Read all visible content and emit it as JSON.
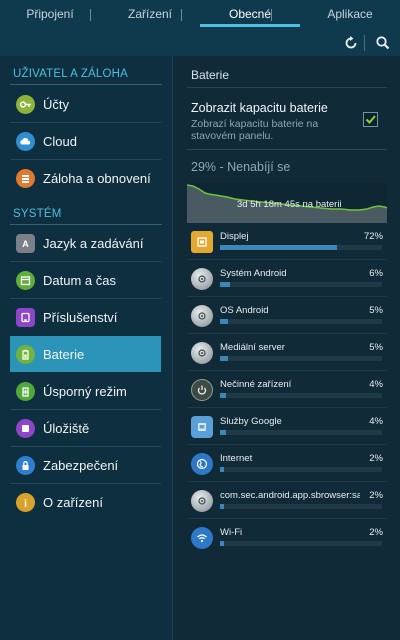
{
  "tabs": [
    {
      "label": "Připojení",
      "active": false
    },
    {
      "label": "Zařízení",
      "active": false
    },
    {
      "label": "Obecné",
      "active": true
    },
    {
      "label": "Aplikace",
      "active": false
    }
  ],
  "actionbar": {
    "refresh_icon": "refresh-icon",
    "search_icon": "search-icon"
  },
  "sidebar": {
    "section1": "UŽIVATEL A ZÁLOHA",
    "section2": "SYSTÉM",
    "items": [
      {
        "label": "Účty",
        "icon": "key-icon",
        "color": "#8cb43a"
      },
      {
        "label": "Cloud",
        "icon": "cloud-icon",
        "color": "#2f8fd0"
      },
      {
        "label": "Záloha a obnovení",
        "icon": "backup-icon",
        "color": "#e07a2e"
      },
      {
        "label": "Jazyk a zadávání",
        "icon": "keyboard-icon",
        "color": "#7a7f88"
      },
      {
        "label": "Datum a čas",
        "icon": "calendar-icon",
        "color": "#5fae3a"
      },
      {
        "label": "Příslušenství",
        "icon": "accessory-icon",
        "color": "#8e46c8"
      },
      {
        "label": "Baterie",
        "icon": "battery-icon",
        "color": "#6fb43c",
        "active": true
      },
      {
        "label": "Úsporný režim",
        "icon": "power-saving-icon",
        "color": "#4fa83a"
      },
      {
        "label": "Úložiště",
        "icon": "storage-icon",
        "color": "#8e46c8"
      },
      {
        "label": "Zabezpečení",
        "icon": "lock-icon",
        "color": "#2f7fd0"
      },
      {
        "label": "O zařízení",
        "icon": "info-icon",
        "color": "#d9a22a"
      }
    ]
  },
  "battery": {
    "title": "Baterie",
    "option_title": "Zobrazit kapacitu baterie",
    "option_desc": "Zobrazí kapacitu baterie na stavovém panelu.",
    "option_checked": true,
    "status": "29% - Nenabíjí se",
    "graph_label": "3d 5h 18m 45s na baterii",
    "usage": [
      {
        "name": "Displej",
        "pct": "72%",
        "value": 72,
        "icon": "display-icon",
        "color": "#e2a830"
      },
      {
        "name": "Systém Android",
        "pct": "6%",
        "value": 6,
        "icon": "android-system-icon",
        "color": "#9aa3a8"
      },
      {
        "name": "OS Android",
        "pct": "5%",
        "value": 5,
        "icon": "android-os-icon",
        "color": "#9aa3a8"
      },
      {
        "name": "Mediální server",
        "pct": "5%",
        "value": 5,
        "icon": "media-server-icon",
        "color": "#9aa3a8"
      },
      {
        "name": "Nečinné zařízení",
        "pct": "4%",
        "value": 4,
        "icon": "idle-power-icon",
        "color": "#3f4a44"
      },
      {
        "name": "Služby Google",
        "pct": "4%",
        "value": 4,
        "icon": "google-services-icon",
        "color": "#5aa0d8"
      },
      {
        "name": "Internet",
        "pct": "2%",
        "value": 2,
        "icon": "globe-icon",
        "color": "#2f78c8"
      },
      {
        "name": "com.sec.android.app.sbrowser:san.",
        "pct": "2%",
        "value": 2,
        "icon": "android-app-icon",
        "color": "#9aa3a8"
      },
      {
        "name": "Wi-Fi",
        "pct": "2%",
        "value": 2,
        "icon": "wifi-icon",
        "color": "#2f78c8"
      }
    ]
  }
}
